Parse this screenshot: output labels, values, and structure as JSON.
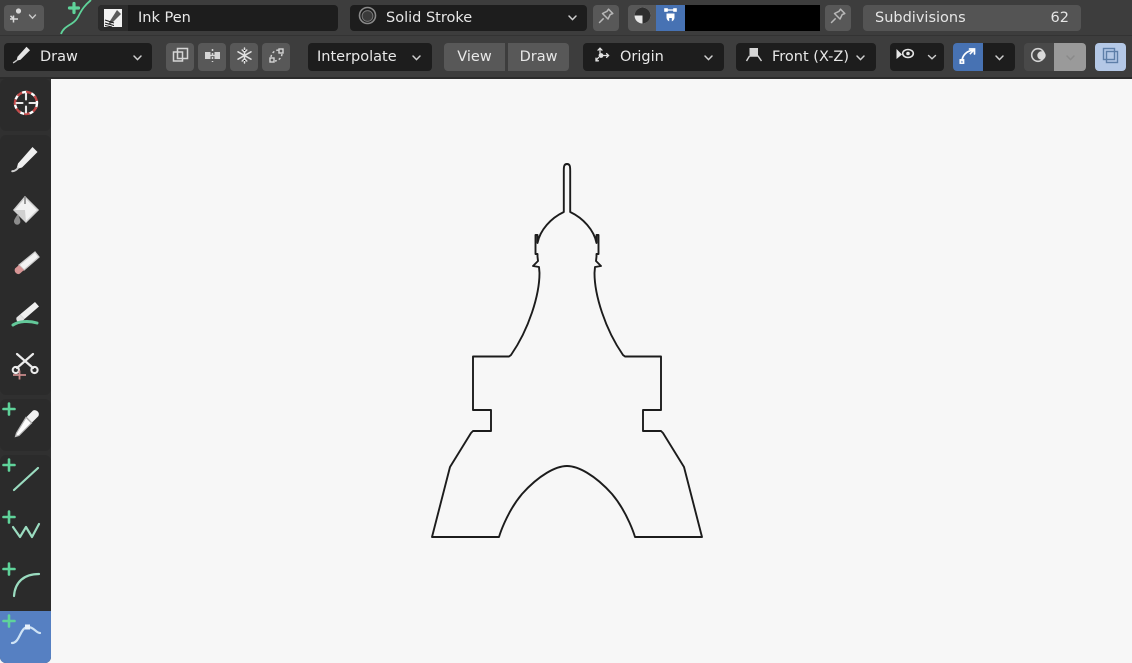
{
  "app": {
    "name": "blender-grease-pencil-draw-mode",
    "canvas_background": "#f7f7f7",
    "header_background": "#3d3d3d",
    "accent_blue": "#4772b3",
    "stroke_color": "#000000"
  },
  "topbar": {
    "brush_selector": {
      "icon": "ink-pen-brush-icon",
      "value": "Ink Pen"
    },
    "add_brush_icon": "add-plus-icon",
    "material_selector": {
      "icon": "material-sphere-icon",
      "value": "Solid Stroke",
      "chevron": "chevron-down-icon"
    },
    "material_pin_icon": "pin-icon",
    "shading_icon": "material-preview-sphere-icon",
    "vertex_color_icon": "vertex-stroke-color-icon",
    "color_swatch": "#000000",
    "color_pin_icon": "pin-icon",
    "subdivisions": {
      "label": "Subdivisions",
      "value": "62"
    }
  },
  "toolrow": {
    "mode": {
      "icon": "draw-pencil-icon",
      "value": "Draw",
      "chevron": "chevron-down-icon"
    },
    "toggles": [
      {
        "name": "stroke-placement-surface-icon"
      },
      {
        "name": "mirror-icon"
      },
      {
        "name": "freeze-snowflake-icon"
      },
      {
        "name": "transform-dashed-box-icon"
      }
    ],
    "interpolate": {
      "value": "Interpolate",
      "chevron": "chevron-down-icon"
    },
    "view_button": "View",
    "draw_button": "Draw",
    "origin": {
      "icon": "stroke-origin-icon",
      "value": "Origin",
      "chevron": "chevron-down-icon"
    },
    "orientation": {
      "icon": "axis-plane-icon",
      "value": "Front (X-Z)",
      "chevron": "chevron-down-icon"
    },
    "right_controls": [
      {
        "name": "visibility-eye-icon",
        "state": "off"
      },
      {
        "name": "snap-magnet-icon",
        "state": "on"
      },
      {
        "name": "proportional-editing-icon",
        "state": "off"
      },
      {
        "name": "overlays-icon",
        "state": "on"
      }
    ]
  },
  "toolbar": {
    "groups": [
      {
        "items": [
          {
            "name": "tool-cursor",
            "icon": "3d-cursor-icon",
            "selected": false,
            "has_plus": false
          }
        ]
      },
      {
        "items": [
          {
            "name": "tool-draw",
            "icon": "pencil-draw-icon",
            "selected": false,
            "has_plus": false
          },
          {
            "name": "tool-fill",
            "icon": "paint-bucket-fill-icon",
            "selected": false,
            "has_plus": false
          },
          {
            "name": "tool-erase",
            "icon": "eraser-icon",
            "selected": false,
            "has_plus": false
          },
          {
            "name": "tool-tint",
            "icon": "tint-brush-icon",
            "selected": false,
            "has_plus": false
          },
          {
            "name": "tool-cutter",
            "icon": "scissors-cutter-icon",
            "selected": false,
            "has_plus": false
          }
        ]
      },
      {
        "items": [
          {
            "name": "tool-eyedropper",
            "icon": "eyedropper-icon",
            "selected": false,
            "has_plus": true
          }
        ]
      },
      {
        "items": [
          {
            "name": "tool-line",
            "icon": "line-icon",
            "selected": false,
            "has_plus": true
          },
          {
            "name": "tool-polyline",
            "icon": "polyline-icon",
            "selected": false,
            "has_plus": true
          },
          {
            "name": "tool-arc",
            "icon": "arc-icon",
            "selected": false,
            "has_plus": true
          },
          {
            "name": "tool-curve",
            "icon": "curve-icon",
            "selected": true,
            "has_plus": true
          }
        ]
      }
    ]
  },
  "canvas": {
    "drawing_name": "eiffel-tower-outline-stroke",
    "stroke_color": "#111111",
    "stroke_width": 2
  }
}
